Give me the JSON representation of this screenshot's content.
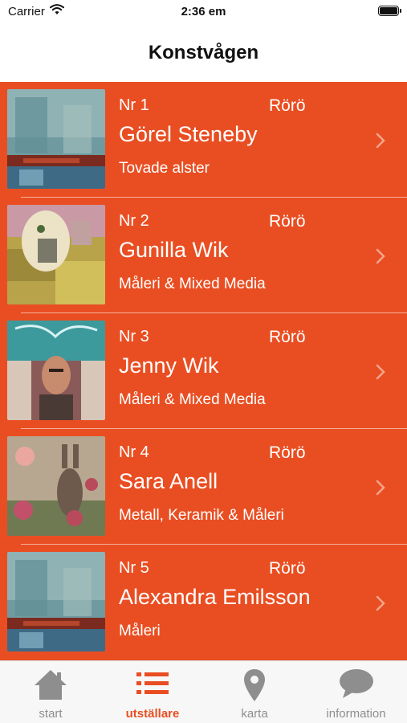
{
  "status_bar": {
    "carrier": "Carrier",
    "time": "2:36 em"
  },
  "nav": {
    "title": "Konstvågen"
  },
  "accent_color": "#e94e22",
  "exhibitors": [
    {
      "number": "Nr 1",
      "place": "Rörö",
      "name": "Görel Steneby",
      "description": "Tovade alster"
    },
    {
      "number": "Nr 2",
      "place": "Rörö",
      "name": "Gunilla Wik",
      "description": "Måleri & Mixed Media"
    },
    {
      "number": "Nr 3",
      "place": "Rörö",
      "name": "Jenny Wik",
      "description": "Måleri & Mixed Media"
    },
    {
      "number": "Nr 4",
      "place": "Rörö",
      "name": "Sara Anell",
      "description": "Metall, Keramik & Måleri"
    },
    {
      "number": "Nr 5",
      "place": "Rörö",
      "name": "Alexandra Emilsson",
      "description": "Måleri"
    }
  ],
  "tabs": [
    {
      "label": "start",
      "icon": "home-icon",
      "active": false
    },
    {
      "label": "utställare",
      "icon": "list-icon",
      "active": true
    },
    {
      "label": "karta",
      "icon": "map-pin-icon",
      "active": false
    },
    {
      "label": "information",
      "icon": "speech-bubble-icon",
      "active": false
    }
  ]
}
